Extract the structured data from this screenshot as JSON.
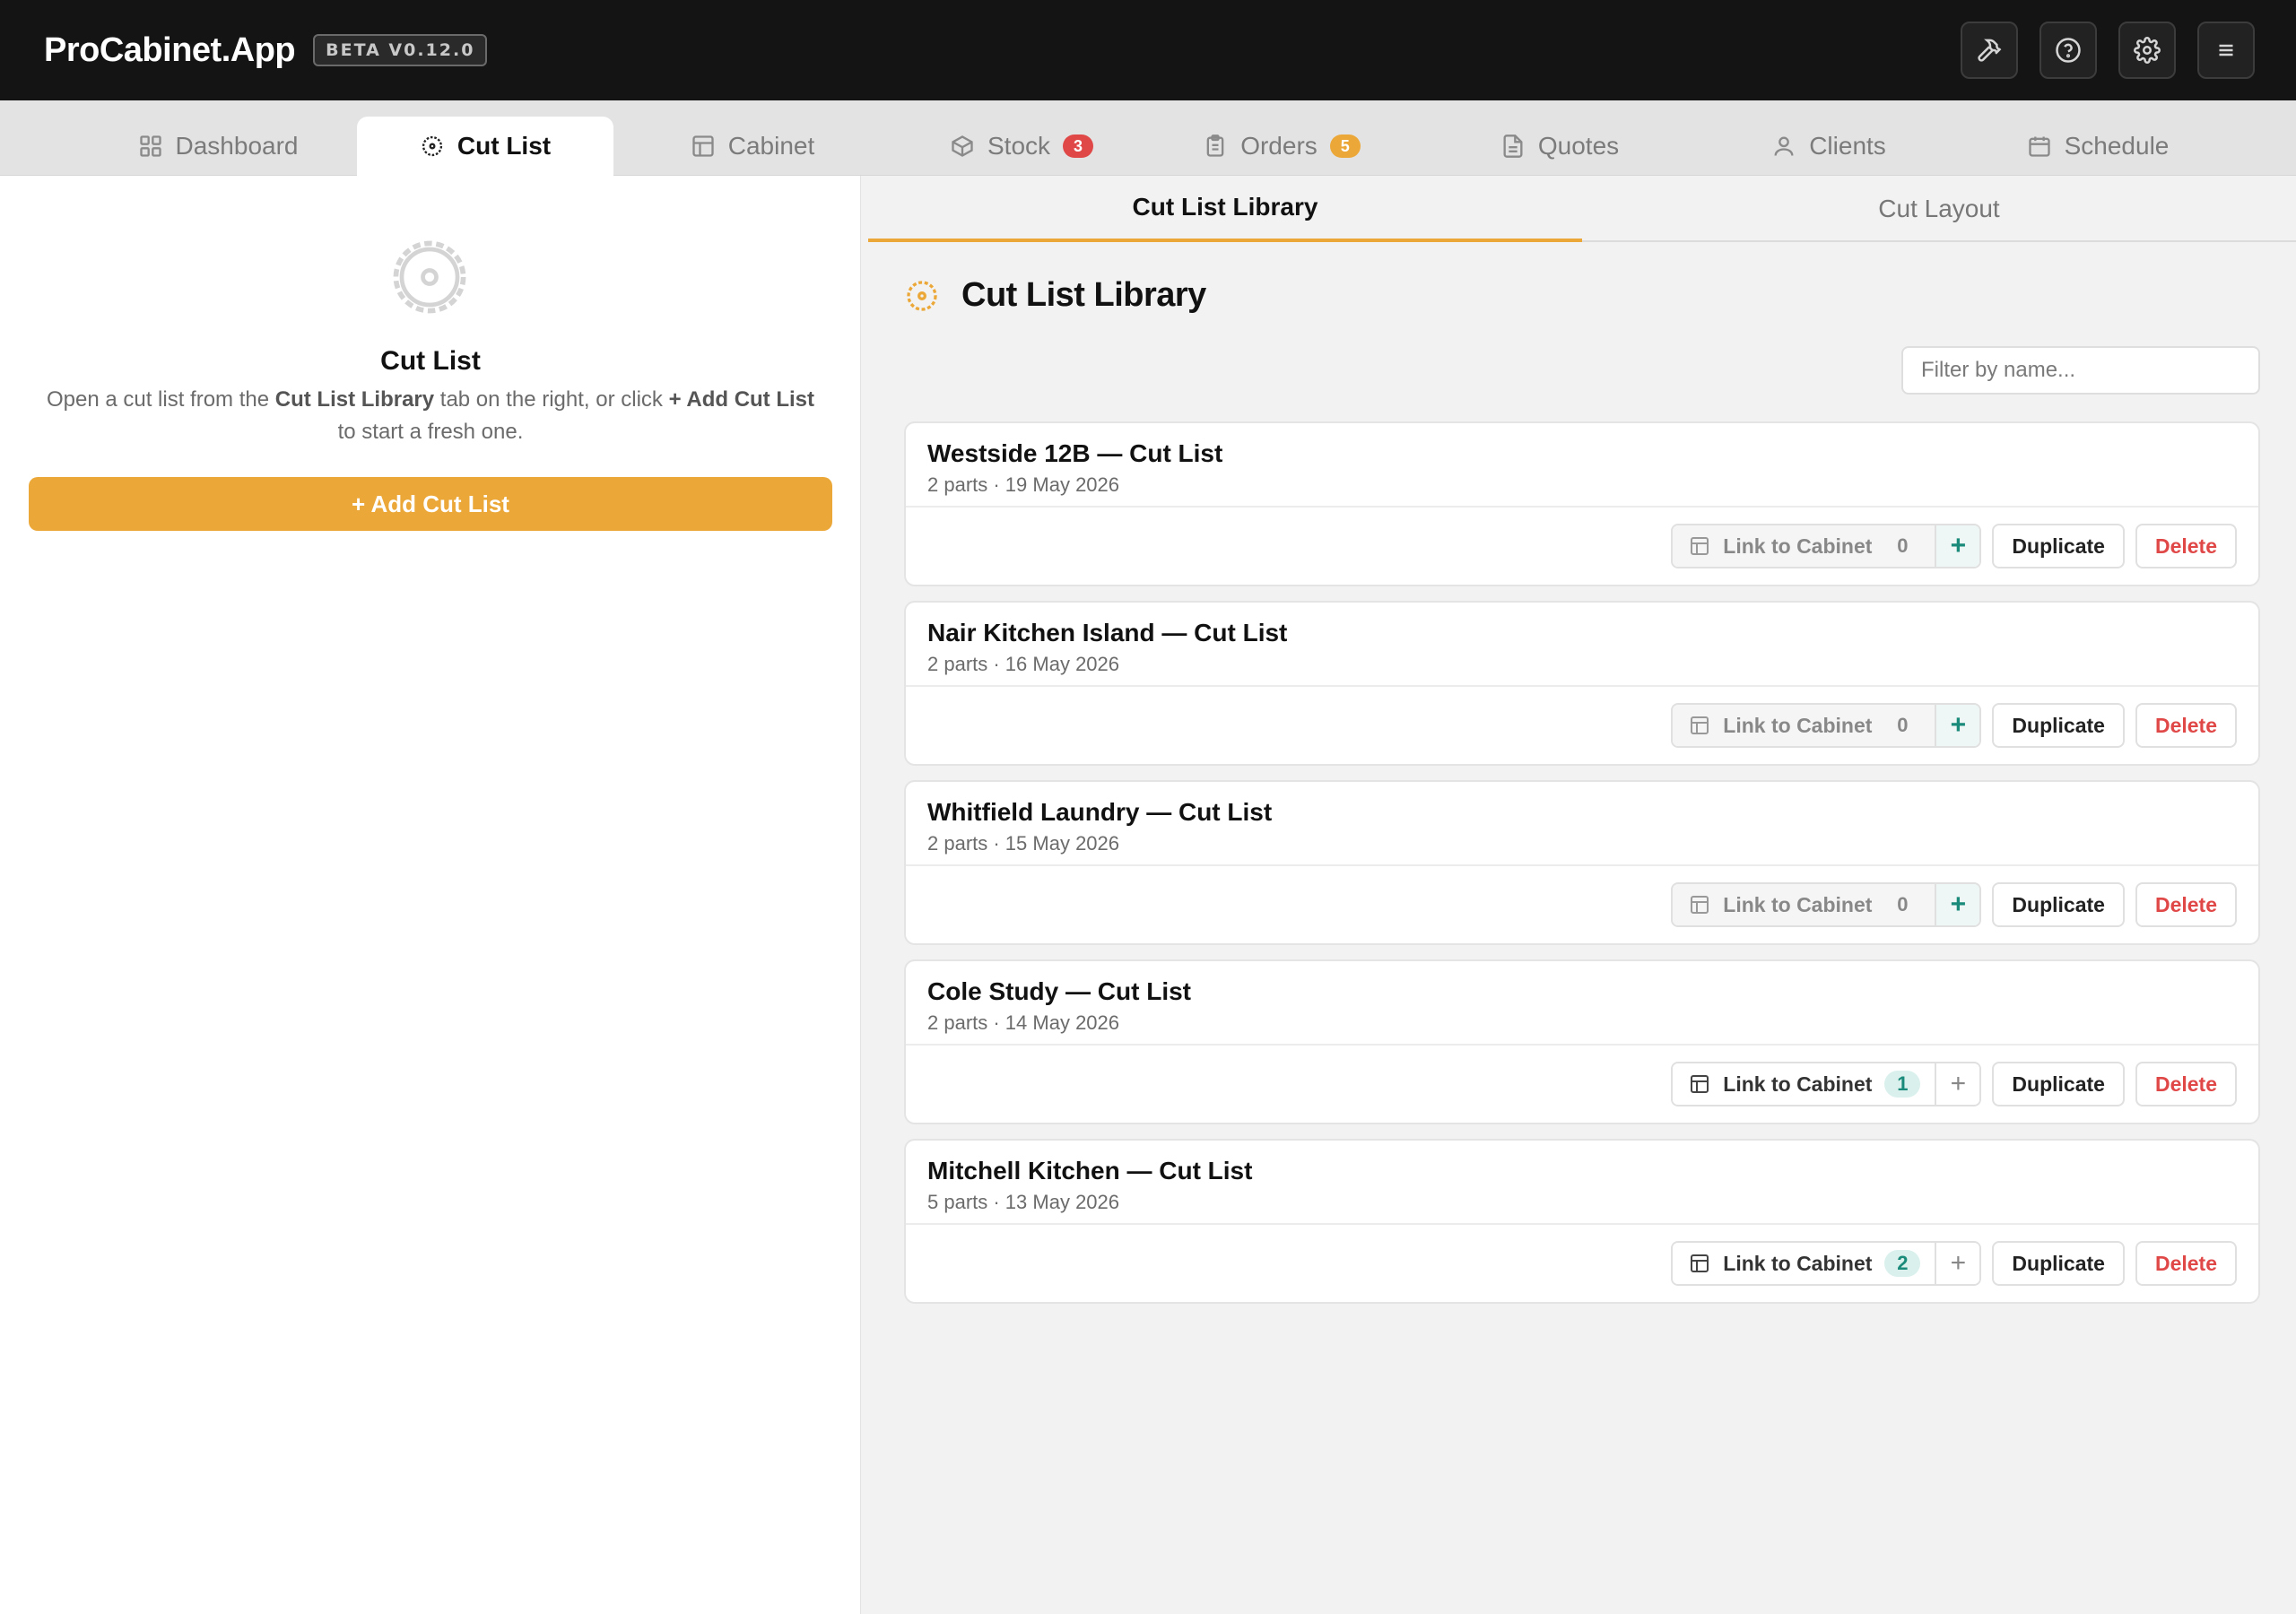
{
  "app": {
    "name": "ProCabinet.App",
    "version": "BETA V0.12.0"
  },
  "header_icons": [
    "hammer-icon",
    "help-icon",
    "gear-icon",
    "menu-icon"
  ],
  "colors": {
    "accent": "#eba838",
    "topbar": "#141414",
    "teal": "#1a8a7a",
    "danger": "#e04848",
    "badge_red": "#e04848",
    "badge_amber": "#eba838"
  },
  "tabs": [
    {
      "label": "Dashboard",
      "icon": "grid-icon"
    },
    {
      "label": "Cut List",
      "icon": "saw-icon",
      "active": true
    },
    {
      "label": "Cabinet",
      "icon": "cabinet-icon"
    },
    {
      "label": "Stock",
      "icon": "box-icon",
      "badge": "3"
    },
    {
      "label": "Orders",
      "icon": "clipboard-icon",
      "badge": "5"
    },
    {
      "label": "Quotes",
      "icon": "document-icon"
    },
    {
      "label": "Clients",
      "icon": "user-icon"
    },
    {
      "label": "Schedule",
      "icon": "calendar-icon"
    }
  ],
  "left_panel": {
    "title": "Cut List",
    "desc_1": "Open a cut list from the ",
    "desc_bold_1": "Cut List Library",
    "desc_2": " tab on the right, or click ",
    "desc_bold_2": "+ Add Cut List",
    "desc_3": " to start a fresh one.",
    "add_button": "+ Add Cut List"
  },
  "subtabs": [
    {
      "label": "Cut List Library",
      "active": true
    },
    {
      "label": "Cut Layout"
    }
  ],
  "library": {
    "title": "Cut List Library",
    "filter_placeholder": "Filter by name...",
    "items": [
      {
        "name": "Westside 12B — Cut List",
        "meta": "2 parts · 19 May 2026",
        "link_label": "Link to Cabinet",
        "linked": "0",
        "plus": "+",
        "duplicate": "Duplicate",
        "delete": "Delete"
      },
      {
        "name": "Nair Kitchen Island — Cut List",
        "meta": "2 parts · 16 May 2026",
        "link_label": "Link to Cabinet",
        "linked": "0",
        "plus": "+",
        "duplicate": "Duplicate",
        "delete": "Delete"
      },
      {
        "name": "Whitfield Laundry — Cut List",
        "meta": "2 parts · 15 May 2026",
        "link_label": "Link to Cabinet",
        "linked": "0",
        "plus": "+",
        "duplicate": "Duplicate",
        "delete": "Delete"
      },
      {
        "name": "Cole Study — Cut List",
        "meta": "2 parts · 14 May 2026",
        "link_label": "Link to Cabinet",
        "linked": "1",
        "plus": "+",
        "duplicate": "Duplicate",
        "delete": "Delete"
      },
      {
        "name": "Mitchell Kitchen — Cut List",
        "meta": "5 parts · 13 May 2026",
        "link_label": "Link to Cabinet",
        "linked": "2",
        "plus": "+",
        "duplicate": "Duplicate",
        "delete": "Delete"
      }
    ]
  }
}
